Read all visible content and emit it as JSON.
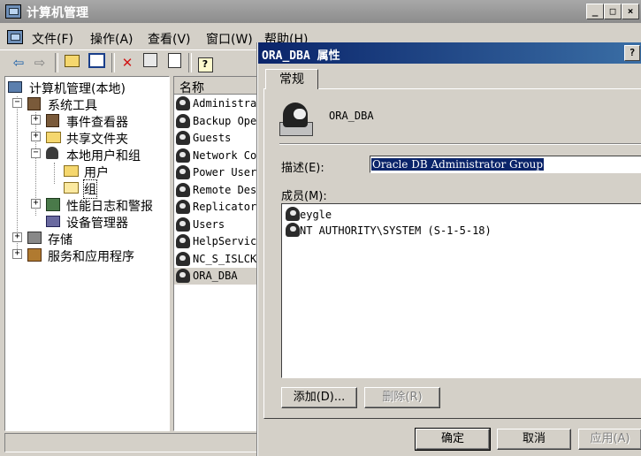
{
  "main_window": {
    "title": "计算机管理",
    "menu": [
      "文件(F)",
      "操作(A)",
      "查看(V)",
      "窗口(W)",
      "帮助(H)"
    ]
  },
  "tree": {
    "root": "计算机管理(本地)",
    "system_tools": "系统工具",
    "event_viewer": "事件查看器",
    "shared_folders": "共享文件夹",
    "local_users_groups": "本地用户和组",
    "users": "用户",
    "groups": "组",
    "perf_logs": "性能日志和警报",
    "device_manager": "设备管理器",
    "storage": "存储",
    "services_apps": "服务和应用程序"
  },
  "list": {
    "column_name": "名称",
    "rows": [
      "Administrat",
      "Backup Oper",
      "Guests",
      "Network Con",
      "Power Users",
      "Remote Desk",
      "Replicator",
      "Users",
      "HelpService",
      "NC_S_ISLCK",
      "ORA_DBA"
    ],
    "selected": "ORA_DBA"
  },
  "dialog": {
    "title": "ORA_DBA 属性",
    "help_glyph": "?",
    "tab": "常规",
    "group_name": "ORA_DBA",
    "description_label": "描述(E):",
    "description_value": "Oracle DB Administrator Group",
    "members_label": "成员(M):",
    "members": [
      "eygle",
      "NT AUTHORITY\\SYSTEM (S-1-5-18)"
    ],
    "add_button": "添加(D)...",
    "remove_button": "删除(R)",
    "ok_button": "确定",
    "cancel_button": "取消",
    "apply_button": "应用(A)"
  }
}
